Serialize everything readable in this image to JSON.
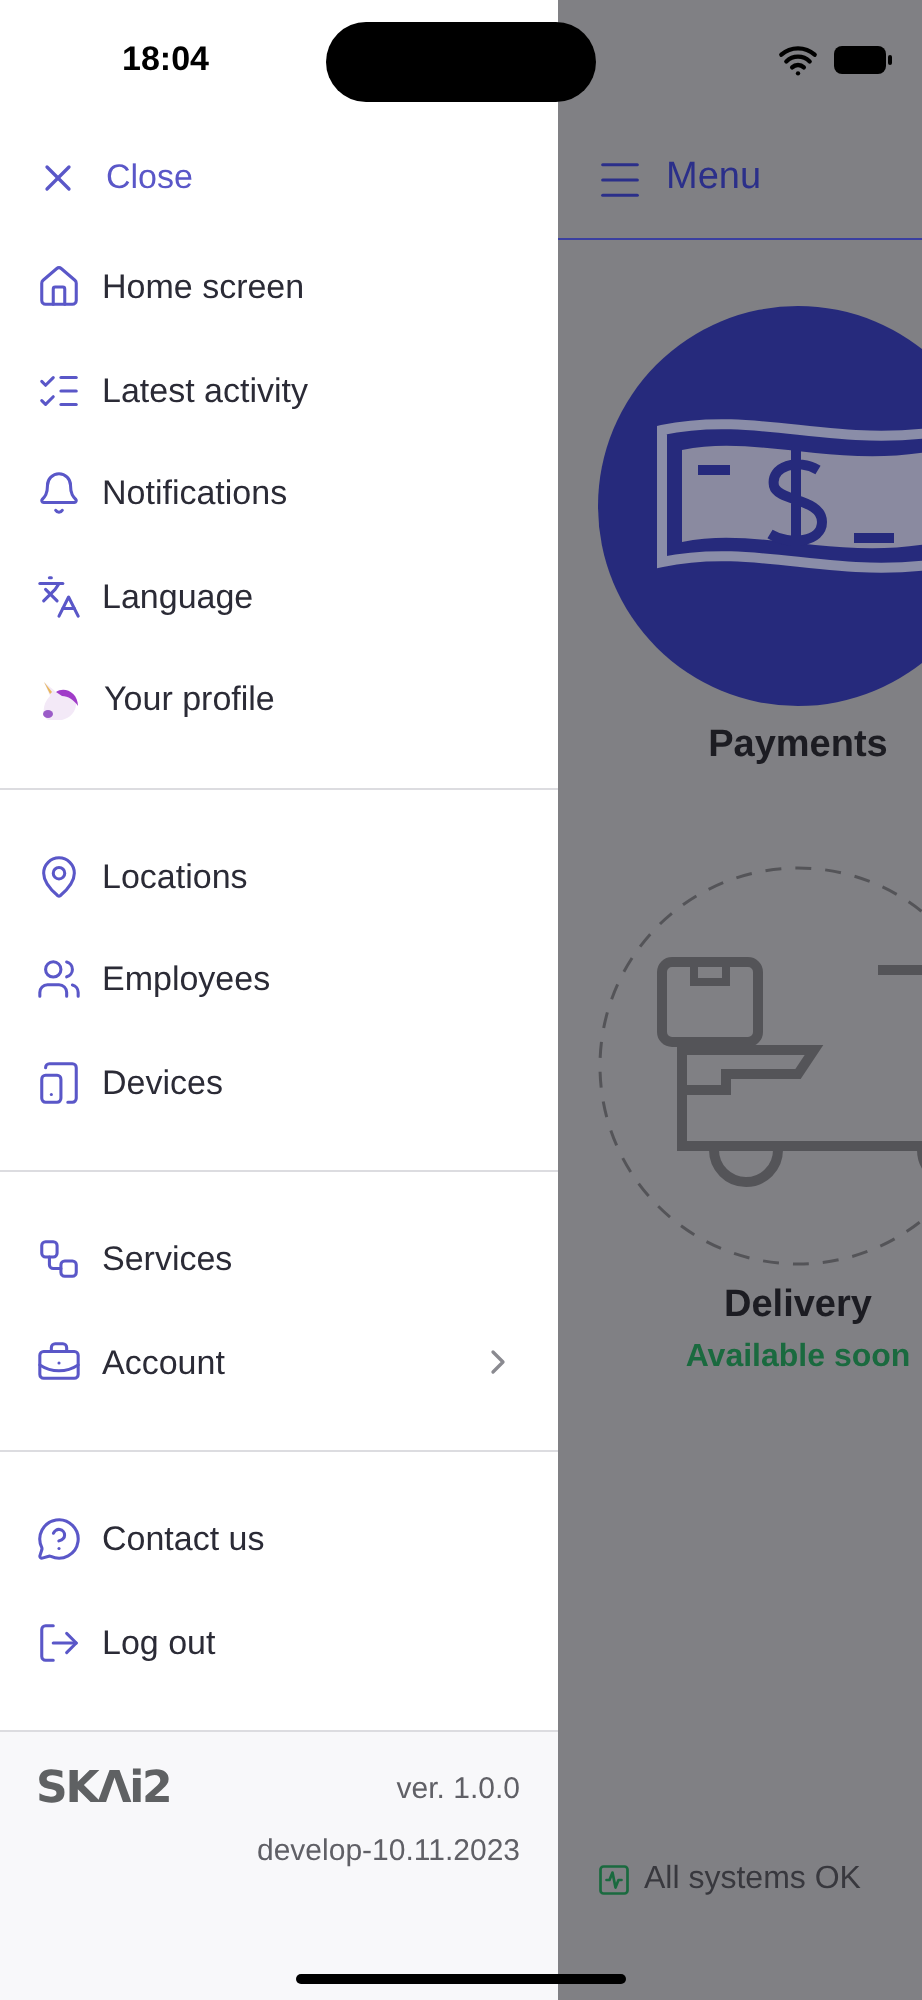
{
  "status_bar": {
    "time": "18:04"
  },
  "drawer": {
    "close": {
      "label": "Close"
    },
    "groups": [
      {
        "items": [
          {
            "label": "Home screen",
            "submenu": false
          },
          {
            "label": "Latest activity",
            "submenu": false
          },
          {
            "label": "Notifications",
            "submenu": false
          },
          {
            "label": "Language",
            "submenu": false
          },
          {
            "label": "Your profile",
            "submenu": false
          }
        ]
      },
      {
        "items": [
          {
            "label": "Locations",
            "submenu": false
          },
          {
            "label": "Employees",
            "submenu": false
          },
          {
            "label": "Devices",
            "submenu": false
          }
        ]
      },
      {
        "items": [
          {
            "label": "Services",
            "submenu": false
          },
          {
            "label": "Account",
            "submenu": true
          }
        ]
      },
      {
        "items": [
          {
            "label": "Contact us",
            "submenu": false
          },
          {
            "label": "Log out",
            "submenu": false
          }
        ]
      }
    ],
    "footer": {
      "logo": "SKΛi2",
      "version": "ver. 1.0.0",
      "build": "develop-10.11.2023"
    }
  },
  "background": {
    "header": {
      "label": "Menu"
    },
    "tiles": [
      {
        "label": "Payments",
        "available": true
      },
      {
        "label": "Delivery",
        "available": false,
        "note": "Available soon"
      }
    ],
    "status": "All systems OK"
  }
}
